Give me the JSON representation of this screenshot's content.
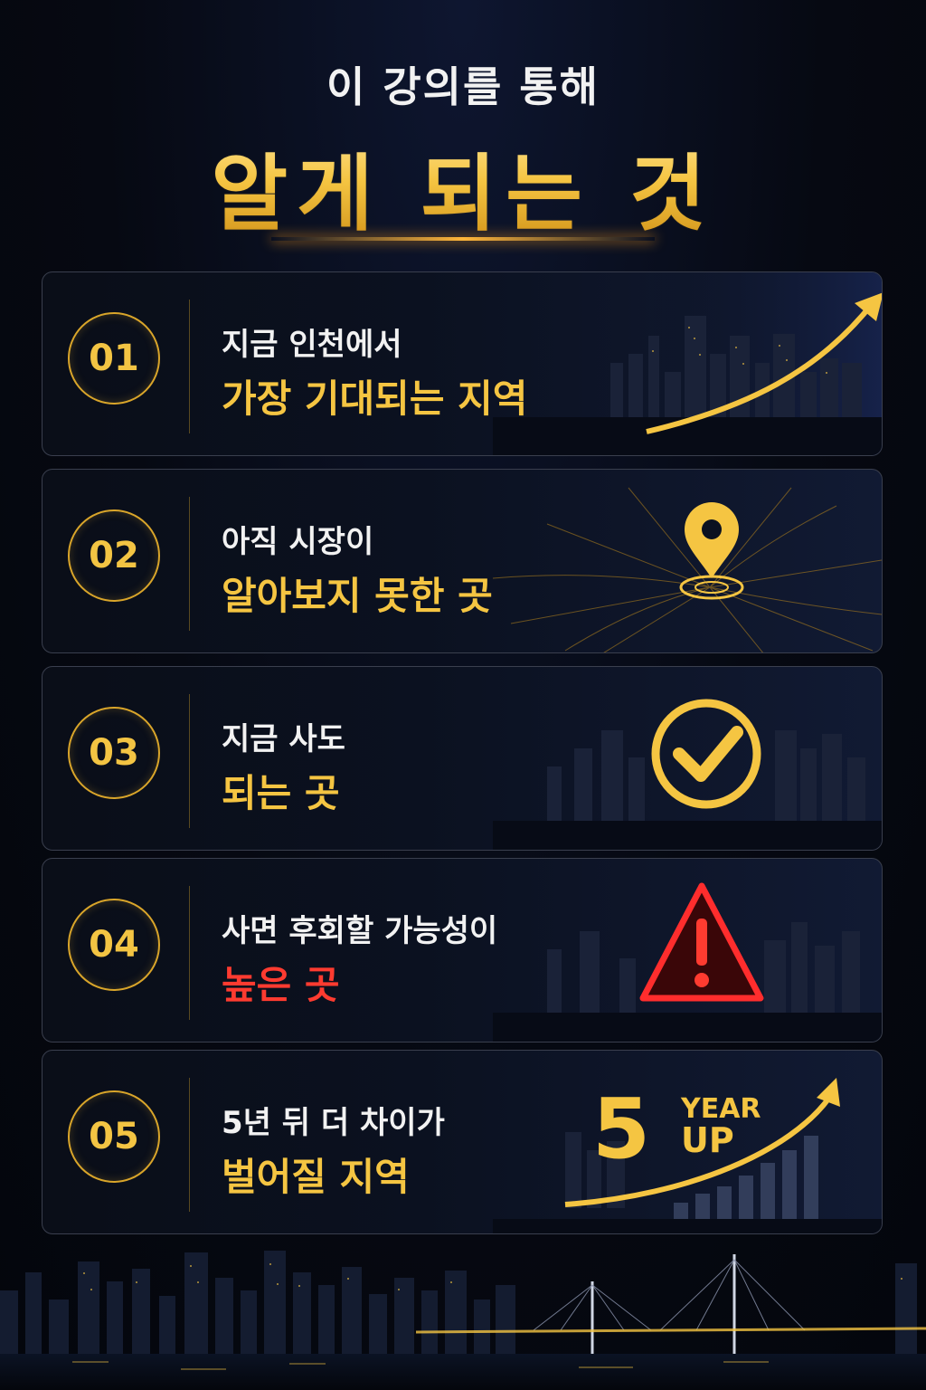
{
  "header": {
    "subtitle": "이 강의를 통해",
    "title": "알게 되는 것"
  },
  "items": [
    {
      "number": "01",
      "line1": "지금 인천에서",
      "line2": "가장 기대되는 지역",
      "icon": "rising-arrow-icon"
    },
    {
      "number": "02",
      "line1": "아직 시장이",
      "line2": "알아보지 못한 곳",
      "icon": "location-pin-icon"
    },
    {
      "number": "03",
      "line1": "지금 사도",
      "line2": "되는 곳",
      "icon": "check-circle-icon"
    },
    {
      "number": "04",
      "line1": "사면 후회할 가능성이",
      "line2": "높은 곳",
      "icon": "warning-icon"
    },
    {
      "number": "05",
      "line1": "5년 뒤 더 차이가",
      "line2": "벌어질 지역",
      "icon": "growth-chart-icon",
      "badge_number": "5",
      "badge_text_1": "YEAR",
      "badge_text_2": "UP"
    }
  ],
  "colors": {
    "gold": "#f5c542",
    "red": "#ff3b30",
    "background": "#060912"
  }
}
